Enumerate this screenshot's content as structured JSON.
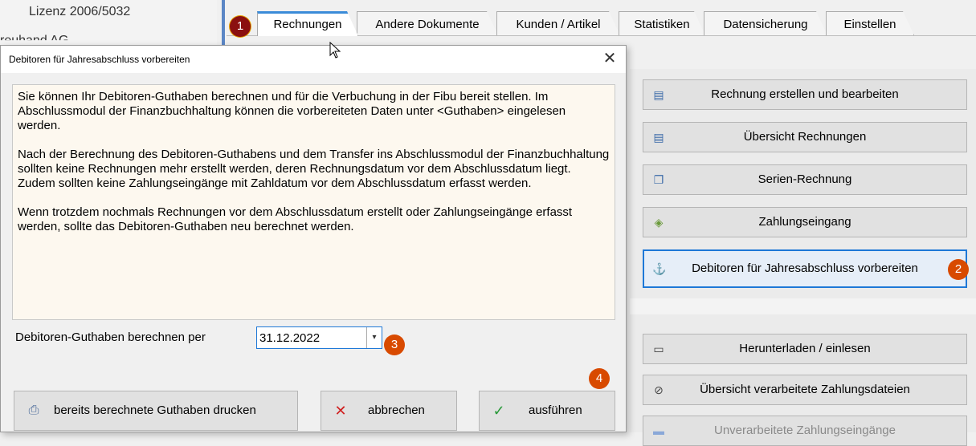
{
  "background": {
    "license": "Lizenz 2006/5032",
    "company_partial": "reuhand AG"
  },
  "tabs": [
    {
      "label": "Rechnungen",
      "active": true
    },
    {
      "label": "Andere Dokumente",
      "active": false
    },
    {
      "label": "Kunden / Artikel",
      "active": false
    },
    {
      "label": "Statistiken",
      "active": false
    },
    {
      "label": "Datensicherung",
      "active": false
    },
    {
      "label": "Einstellen",
      "active": false
    }
  ],
  "right_buttons": [
    {
      "label": "Rechnung erstellen und bearbeiten",
      "icon": "invoice-edit-icon"
    },
    {
      "label": "Übersicht Rechnungen",
      "icon": "invoice-search-icon"
    },
    {
      "label": "Serien-Rechnung",
      "icon": "copy-documents-icon"
    },
    {
      "label": "Zahlungseingang",
      "icon": "payment-icon"
    },
    {
      "label": "Debitoren für Jahresabschluss vorbereiten",
      "icon": "anchor-icon"
    },
    {
      "label": "Herunterladen / einlesen",
      "icon": "speech-bubble-icon"
    },
    {
      "label": "Übersicht verarbeitete Zahlungsdateien",
      "icon": "compass-icon"
    },
    {
      "label": "Unverarbeitete Zahlungseingänge",
      "icon": "list-icon"
    }
  ],
  "dialog": {
    "title": "Debitoren für Jahresabschluss vorbereiten",
    "close_symbol": "✕",
    "info": [
      "Sie können Ihr Debitoren-Guthaben berechnen und für die Verbuchung in der Fibu bereit stellen. Im Abschlussmodul der Finanzbuchhaltung können die vorbereiteten Daten unter <Guthaben> eingelesen werden.",
      "Nach der Berechnung des Debitoren-Guthabens und dem Transfer ins Abschlussmodul der Finanzbuchhaltung sollten keine Rechnungen mehr erstellt werden, deren Rechnungsdatum vor dem Abschlussdatum liegt. Zudem sollten keine Zahlungseingänge mit Zahldatum vor dem Abschlussdatum erfasst werden.",
      "Wenn trotzdem nochmals Rechnungen vor dem Abschlussdatum erstellt oder Zahlungseingänge erfasst werden, sollte das Debitoren-Guthaben neu berechnet werden."
    ],
    "calc_label": "Debitoren-Guthaben berechnen per",
    "date_value": "31.12.2022",
    "buttons": {
      "print": "bereits berechnete Guthaben drucken",
      "cancel": "abbrechen",
      "execute": "ausführen"
    }
  },
  "badges": [
    "1",
    "2",
    "3",
    "4"
  ]
}
